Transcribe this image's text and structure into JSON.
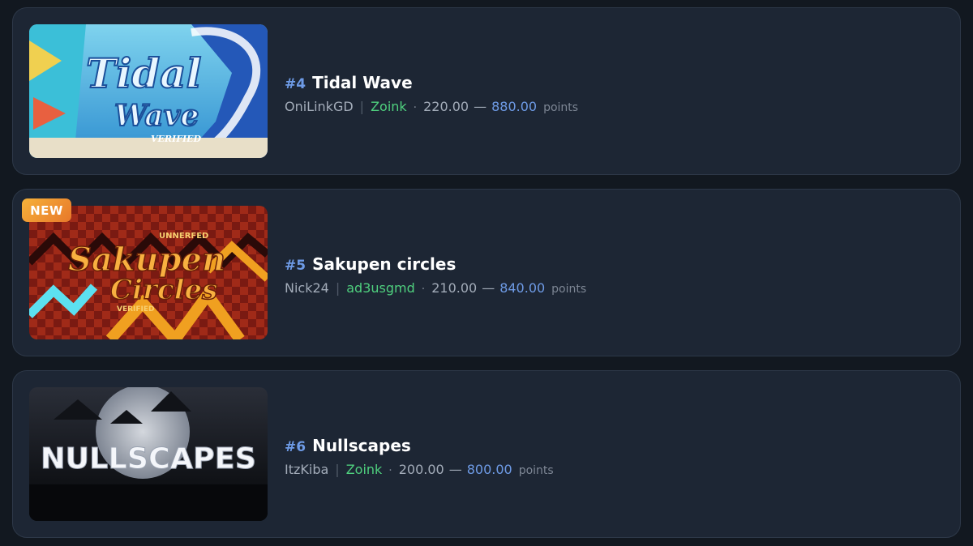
{
  "levels": [
    {
      "rank": "#4",
      "name": "Tidal Wave",
      "creator": "OniLinkGD",
      "verifier": "Zoink",
      "points_min": "220.00",
      "points_max": "880.00",
      "points_unit": "points",
      "thumbnail": {
        "line1": "Tidal",
        "line2": "Wave",
        "caption": "VERIFIED"
      }
    },
    {
      "rank": "#5",
      "name": "Sakupen circles",
      "creator": "Nick24",
      "verifier": "ad3usgmd",
      "points_min": "210.00",
      "points_max": "840.00",
      "points_unit": "points",
      "badge": "NEW",
      "thumbnail": {
        "top": "UNNERFED",
        "line1": "Sakupen",
        "line2": "Circles",
        "caption": "VERIFIED"
      }
    },
    {
      "rank": "#6",
      "name": "Nullscapes",
      "creator": "ItzKiba",
      "verifier": "Zoink",
      "points_min": "200.00",
      "points_max": "800.00",
      "points_unit": "points",
      "thumbnail": {
        "line1": "NULLSCAPES"
      }
    }
  ],
  "separators": {
    "pipe": "|",
    "dot": "·",
    "dash": "—"
  },
  "colors": {
    "background": "#121820",
    "card": "#1d2634",
    "rank": "#6e9be6",
    "verifier": "#4fd07e",
    "points_max": "#6e9be6",
    "badge": "#f0a030"
  }
}
